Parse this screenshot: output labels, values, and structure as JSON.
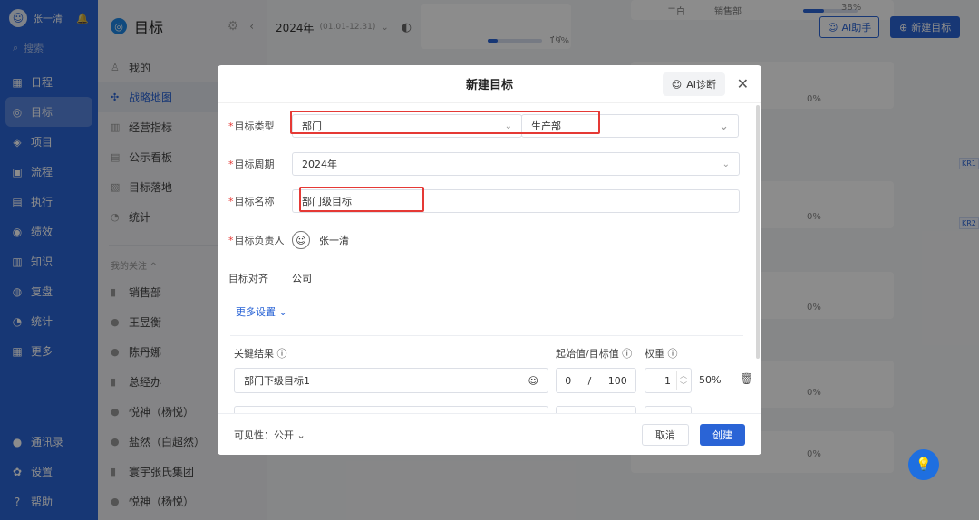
{
  "nav": {
    "username": "张一清",
    "search_placeholder": "搜索",
    "items": [
      {
        "icon": "calendar-icon",
        "glyph": "▦",
        "label": "日程"
      },
      {
        "icon": "target-icon",
        "glyph": "◎",
        "label": "目标"
      },
      {
        "icon": "cube-icon",
        "glyph": "◈",
        "label": "项目"
      },
      {
        "icon": "flow-icon",
        "glyph": "▣",
        "label": "流程"
      },
      {
        "icon": "execute-icon",
        "glyph": "▤",
        "label": "执行"
      },
      {
        "icon": "performance-icon",
        "glyph": "◉",
        "label": "绩效"
      },
      {
        "icon": "book-icon",
        "glyph": "▥",
        "label": "知识"
      },
      {
        "icon": "review-icon",
        "glyph": "◍",
        "label": "复盘"
      },
      {
        "icon": "pie-icon",
        "glyph": "◔",
        "label": "统计"
      },
      {
        "icon": "grid-icon",
        "glyph": "▦",
        "label": "更多"
      }
    ],
    "bottom": [
      {
        "icon": "contacts-icon",
        "glyph": "●",
        "label": "通讯录"
      },
      {
        "icon": "gear-icon",
        "glyph": "✿",
        "label": "设置"
      },
      {
        "icon": "help-icon",
        "glyph": "?",
        "label": "帮助"
      }
    ]
  },
  "side": {
    "title": "目标",
    "items": [
      {
        "label": "我的",
        "glyph": "♙"
      },
      {
        "label": "战略地图",
        "glyph": "✣"
      },
      {
        "label": "经营指标",
        "glyph": "▥"
      },
      {
        "label": "公示看板",
        "glyph": "▤"
      },
      {
        "label": "目标落地",
        "glyph": "▧"
      },
      {
        "label": "统计",
        "glyph": "◔"
      }
    ],
    "follow_section": "我的关注 ^",
    "follows": [
      {
        "label": "销售部",
        "glyph": "▮"
      },
      {
        "label": "王昱衡",
        "glyph": "●"
      },
      {
        "label": "陈丹娜",
        "glyph": "●"
      },
      {
        "label": "总经办",
        "glyph": "▮"
      },
      {
        "label": "悦神（杨悦）",
        "glyph": "●"
      },
      {
        "label": "盐然（白超然）",
        "glyph": "●"
      },
      {
        "label": "寰宇张氏集团",
        "glyph": "▮"
      },
      {
        "label": "悦神（杨悦）",
        "glyph": "●"
      }
    ]
  },
  "topbar": {
    "year": "2024年",
    "year_range": "(01.01-12.31)",
    "ai_helper": "AI助手",
    "new_goal": "新建目标"
  },
  "map": {
    "top_card_progress": 19,
    "top_card_pct": "19%",
    "top_right_pct": "38%",
    "top_right_name": "二白",
    "top_right_dept": "销售部",
    "pcts": [
      "0%",
      "0%",
      "0%",
      "0%",
      "0%"
    ],
    "kr_tags": [
      "KR1",
      "KR2"
    ]
  },
  "modal": {
    "title": "新建目标",
    "ai_diag": "AI诊断",
    "type_label": "目标类型",
    "type_value": "部门",
    "dept_value": "生产部",
    "period_label": "目标周期",
    "period_value": "2024年",
    "name_label": "目标名称",
    "name_value": "部门级目标",
    "owner_label": "目标负责人",
    "owner_value": "张一清",
    "align_label": "目标对齐",
    "align_value": "公司",
    "more_settings": "更多设置 ⌄",
    "kr_header": "关键结果 ⓘ",
    "start_target_header": "起始值/目标值 ⓘ",
    "weight_header": "权重 ⓘ",
    "kr_row": {
      "name": "部门下级目标1",
      "start": "0",
      "sep": "/",
      "target": "100",
      "weight": "1",
      "weight_pct": "50%"
    },
    "visibility": "可见性：公开 ⌄",
    "cancel": "取消",
    "create": "创建"
  }
}
